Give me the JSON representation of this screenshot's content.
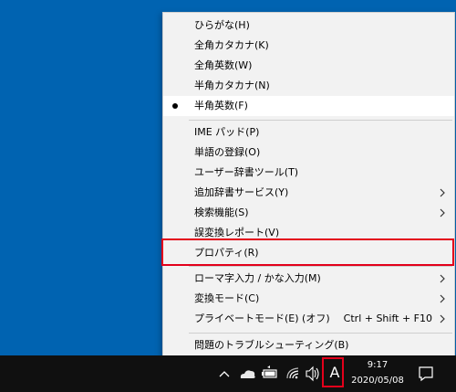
{
  "menu": {
    "items": [
      {
        "label": "ひらがな(H)"
      },
      {
        "label": "全角カタカナ(K)"
      },
      {
        "label": "全角英数(W)"
      },
      {
        "label": "半角カタカナ(N)"
      },
      {
        "label": "半角英数(F)",
        "checked": true
      },
      {
        "label": "IME パッド(P)"
      },
      {
        "label": "単語の登録(O)"
      },
      {
        "label": "ユーザー辞書ツール(T)"
      },
      {
        "label": "追加辞書サービス(Y)",
        "submenu": true
      },
      {
        "label": "検索機能(S)",
        "submenu": true
      },
      {
        "label": "誤変換レポート(V)"
      },
      {
        "label": "プロパティ(R)",
        "highlighted": true
      },
      {
        "label": "ローマ字入力 / かな入力(M)",
        "submenu": true
      },
      {
        "label": "変換モード(C)",
        "submenu": true
      },
      {
        "label": "プライベートモード(E) (オフ)",
        "shortcut": "Ctrl + Shift + F10",
        "submenu": true
      },
      {
        "label": "問題のトラブルシューティング(B)"
      }
    ]
  },
  "taskbar": {
    "ime_indicator": "A",
    "time": "9:17",
    "date": "2020/05/08",
    "icons": [
      "chevron-up-icon",
      "onedrive-icon",
      "battery-icon",
      "wifi-icon",
      "speaker-icon",
      "notification-icon"
    ]
  },
  "colors": {
    "desktop": "#0063b1",
    "menu_bg": "#f2f2f2",
    "highlight_box": "#e3001b",
    "taskbar": "#101010"
  }
}
